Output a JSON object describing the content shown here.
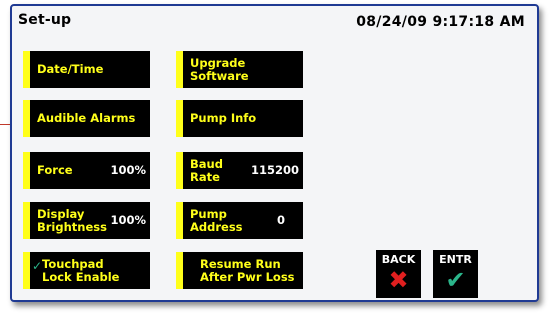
{
  "header": {
    "title": "Set-up",
    "datetime": "08/24/09 9:17:18 AM"
  },
  "buttons": {
    "date_time": "Date/Time",
    "upgrade_software": "Upgrade\nSoftware",
    "audible_alarms": "Audible Alarms",
    "pump_info": "Pump Info",
    "force_label": "Force",
    "force_value": "100%",
    "baud_rate_label": "Baud Rate",
    "baud_rate_value": "115200",
    "display_brightness_label": "Display\nBrightness",
    "display_brightness_value": "100%",
    "pump_address_label": "Pump\nAddress",
    "pump_address_value": "0",
    "touchpad_lock_label": "Touchpad\nLock Enable",
    "touchpad_lock_checked": true,
    "resume_run_label": "Resume Run\nAfter Pwr Loss"
  },
  "nav": {
    "back_label": "BACK",
    "enter_label": "ENTR"
  },
  "colors": {
    "button_bg": "#000000",
    "button_accent": "#ffff1a",
    "value_text": "#ffffff",
    "back_x": "#e01f1f",
    "enter_check": "#2bb58a",
    "frame_border": "#1f3a93"
  },
  "icons": {
    "back": "x-icon",
    "enter": "check-icon",
    "touchpad_check": "check-icon"
  }
}
